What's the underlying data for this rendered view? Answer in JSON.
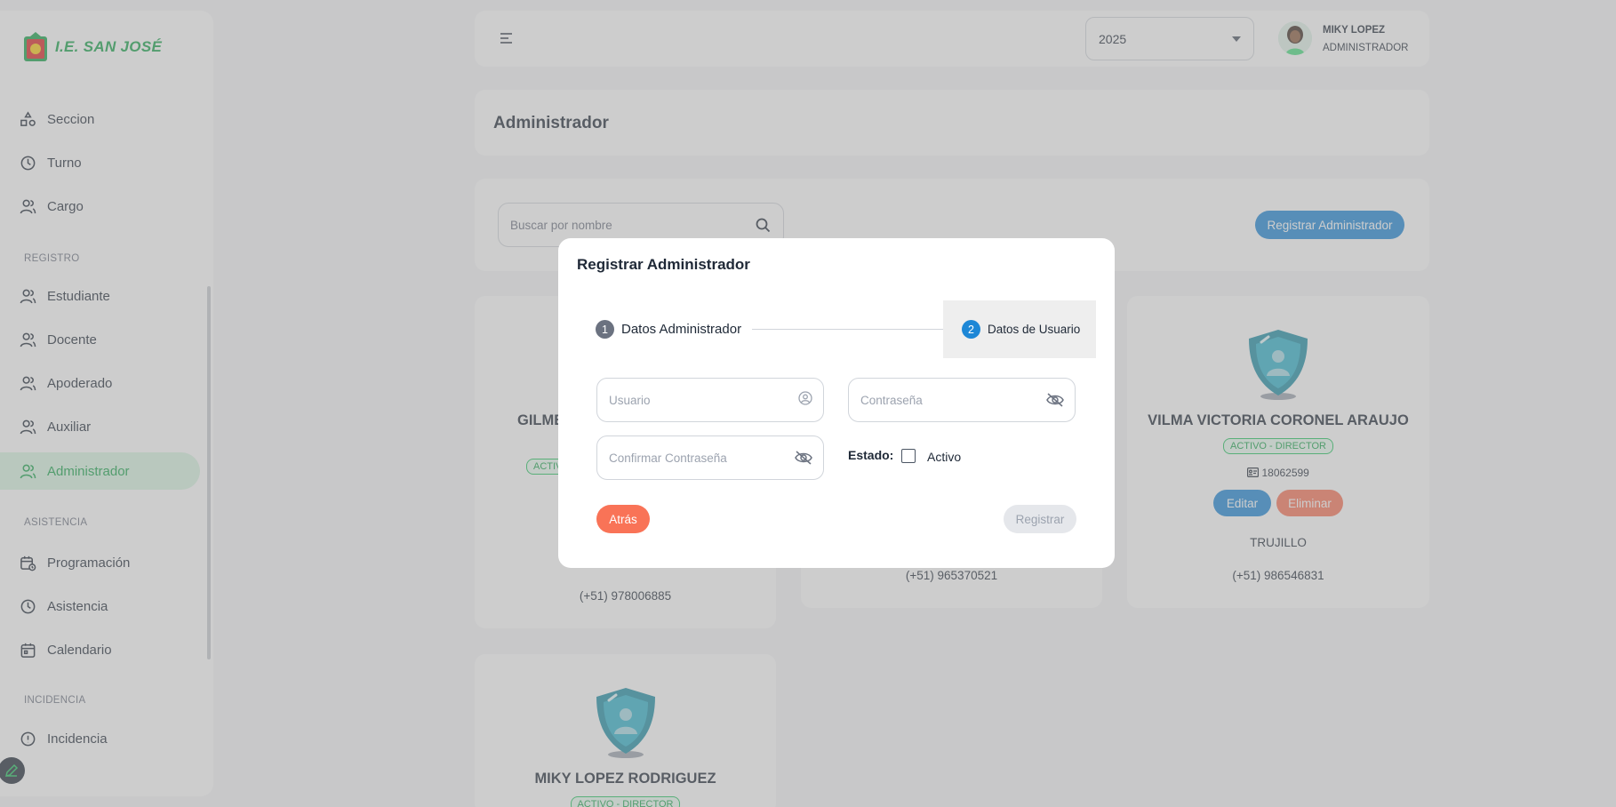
{
  "brand": {
    "name": "I.E. SAN JOSÉ"
  },
  "sidebar": {
    "items": [
      {
        "label": "Seccion",
        "icon": "section-icon"
      },
      {
        "label": "Turno",
        "icon": "clock-icon"
      },
      {
        "label": "Cargo",
        "icon": "users-icon"
      },
      {
        "label": "Estudiante",
        "icon": "users-icon"
      },
      {
        "label": "Docente",
        "icon": "users-icon"
      },
      {
        "label": "Apoderado",
        "icon": "users-icon"
      },
      {
        "label": "Auxiliar",
        "icon": "users-icon"
      },
      {
        "label": "Administrador",
        "icon": "users-icon",
        "active": true
      },
      {
        "label": "Programación",
        "icon": "calendar-clock-icon"
      },
      {
        "label": "Asistencia",
        "icon": "clock-icon"
      },
      {
        "label": "Calendario",
        "icon": "calendar-icon"
      },
      {
        "label": "Incidencia",
        "icon": "alert-icon"
      }
    ],
    "sections": [
      "REGISTRO",
      "ASISTENCIA",
      "INCIDENCIA"
    ]
  },
  "topbar": {
    "year": "2025",
    "user_name": "MIKY LOPEZ",
    "user_role": "ADMINISTRADOR"
  },
  "page": {
    "title": "Administrador"
  },
  "search": {
    "placeholder": "Buscar por nombre",
    "register_label": "Registrar Administrador"
  },
  "cards": [
    {
      "name": "GILME",
      "badge": "ACTIV",
      "phone": "(+51) 978006885"
    },
    {
      "phone": "(+51) 965370521"
    },
    {
      "name": "VILMA VICTORIA CORONEL ARAUJO",
      "badge": "ACTIVO - DIRECTOR",
      "dni": "18062599",
      "edit_label": "Editar",
      "delete_label": "Eliminar",
      "city": "TRUJILLO",
      "phone": "(+51) 986546831"
    },
    {
      "name": "MIKY LOPEZ RODRIGUEZ",
      "badge": "ACTIVO - DIRECTOR"
    }
  ],
  "modal": {
    "title": "Registrar Administrador",
    "step1": {
      "number": "1",
      "label": "Datos Administrador"
    },
    "step2": {
      "number": "2",
      "label": "Datos de Usuario"
    },
    "usuario_placeholder": "Usuario",
    "password_placeholder": "Contraseña",
    "confirm_placeholder": "Confirmar Contraseña",
    "estado_label": "Estado:",
    "activo_label": "Activo",
    "back_label": "Atrás",
    "submit_label": "Registrar"
  },
  "colors": {
    "accent_green": "#16a34a",
    "primary_blue": "#1d87d6",
    "danger_orange": "#f97357",
    "teal_shield": "#1e8fa6"
  }
}
